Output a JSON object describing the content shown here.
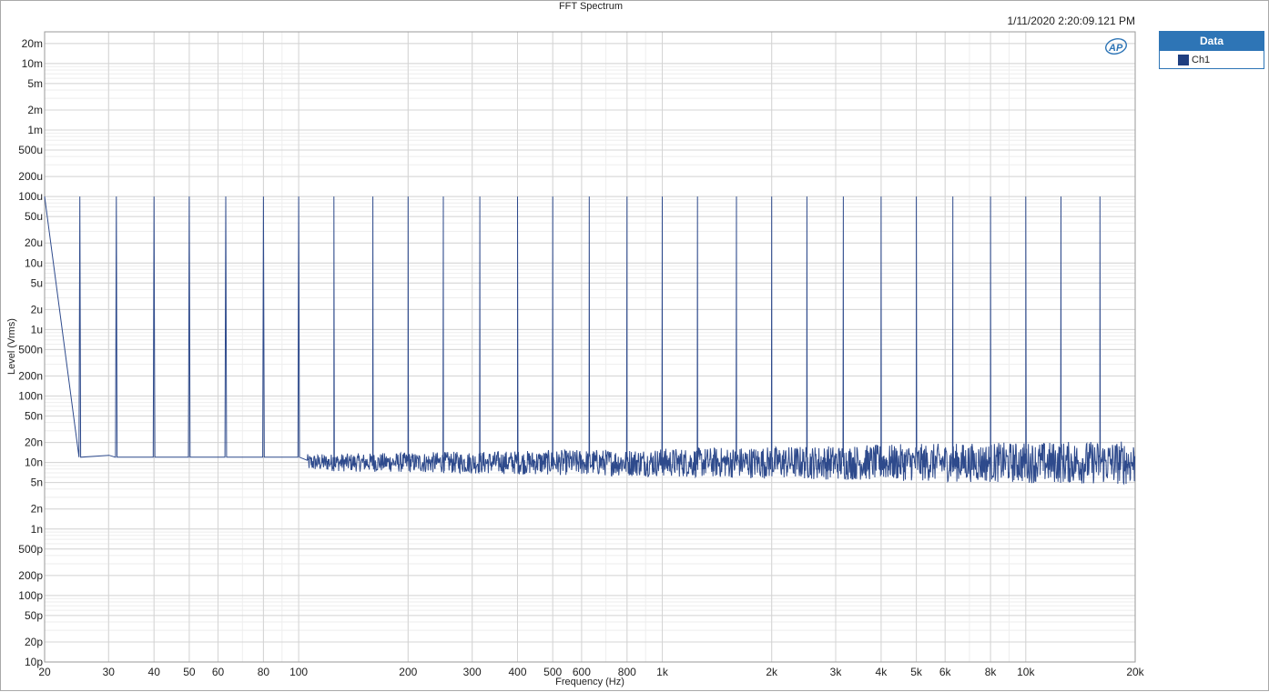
{
  "chart_data": {
    "type": "line",
    "title": "FFT Spectrum",
    "timestamp": "1/11/2020 2:20:09.121 PM",
    "xlabel": "Frequency (Hz)",
    "ylabel": "Level (Vrms)",
    "x_scale": "log",
    "y_scale": "log",
    "xlim": [
      20,
      20000
    ],
    "ylim": [
      1e-11,
      0.03
    ],
    "grid": true,
    "legend": {
      "title": "Data",
      "placement": "right",
      "entries": [
        {
          "name": "Ch1",
          "color": "#1f3f80"
        }
      ]
    },
    "x_ticks": [
      {
        "value": 20,
        "label": "20"
      },
      {
        "value": 30,
        "label": "30"
      },
      {
        "value": 40,
        "label": "40"
      },
      {
        "value": 50,
        "label": "50"
      },
      {
        "value": 60,
        "label": "60"
      },
      {
        "value": 80,
        "label": "80"
      },
      {
        "value": 100,
        "label": "100"
      },
      {
        "value": 200,
        "label": "200"
      },
      {
        "value": 300,
        "label": "300"
      },
      {
        "value": 400,
        "label": "400"
      },
      {
        "value": 500,
        "label": "500"
      },
      {
        "value": 600,
        "label": "600"
      },
      {
        "value": 800,
        "label": "800"
      },
      {
        "value": 1000,
        "label": "1k"
      },
      {
        "value": 2000,
        "label": "2k"
      },
      {
        "value": 3000,
        "label": "3k"
      },
      {
        "value": 4000,
        "label": "4k"
      },
      {
        "value": 5000,
        "label": "5k"
      },
      {
        "value": 6000,
        "label": "6k"
      },
      {
        "value": 8000,
        "label": "8k"
      },
      {
        "value": 10000,
        "label": "10k"
      },
      {
        "value": 20000,
        "label": "20k"
      }
    ],
    "y_ticks": [
      {
        "value": 0.02,
        "label": "20m"
      },
      {
        "value": 0.01,
        "label": "10m"
      },
      {
        "value": 0.005,
        "label": "5m"
      },
      {
        "value": 0.002,
        "label": "2m"
      },
      {
        "value": 0.001,
        "label": "1m"
      },
      {
        "value": 0.0005,
        "label": "500u"
      },
      {
        "value": 0.0002,
        "label": "200u"
      },
      {
        "value": 0.0001,
        "label": "100u"
      },
      {
        "value": 5e-05,
        "label": "50u"
      },
      {
        "value": 2e-05,
        "label": "20u"
      },
      {
        "value": 1e-05,
        "label": "10u"
      },
      {
        "value": 5e-06,
        "label": "5u"
      },
      {
        "value": 2e-06,
        "label": "2u"
      },
      {
        "value": 1e-06,
        "label": "1u"
      },
      {
        "value": 5e-07,
        "label": "500n"
      },
      {
        "value": 2e-07,
        "label": "200n"
      },
      {
        "value": 1e-07,
        "label": "100n"
      },
      {
        "value": 5e-08,
        "label": "50n"
      },
      {
        "value": 2e-08,
        "label": "20n"
      },
      {
        "value": 1e-08,
        "label": "10n"
      },
      {
        "value": 5e-09,
        "label": "5n"
      },
      {
        "value": 2e-09,
        "label": "2n"
      },
      {
        "value": 1e-09,
        "label": "1n"
      },
      {
        "value": 5e-10,
        "label": "500p"
      },
      {
        "value": 2e-10,
        "label": "200p"
      },
      {
        "value": 1e-10,
        "label": "100p"
      },
      {
        "value": 5e-11,
        "label": "50p"
      },
      {
        "value": 2e-11,
        "label": "20p"
      },
      {
        "value": 1e-11,
        "label": "10p"
      }
    ],
    "series": [
      {
        "name": "Ch1",
        "color": "#2e4a8c",
        "tone_level": 0.0001,
        "noise_floor_low": 1e-08,
        "noise_floor_high": 1e-08,
        "tones_hz": [
          20,
          25,
          31.5,
          40,
          50,
          63,
          80,
          100,
          125,
          160,
          200,
          250,
          315,
          400,
          500,
          630,
          800,
          1000,
          1250,
          1600,
          2000,
          2500,
          3150,
          4000,
          5000,
          6300,
          8000,
          10000,
          12500,
          16000
        ]
      }
    ]
  }
}
